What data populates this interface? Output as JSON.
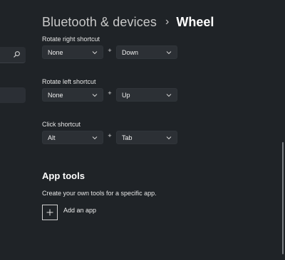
{
  "header": {
    "parent": "Bluetooth & devices",
    "separator": "›",
    "current": "Wheel"
  },
  "shortcuts": [
    {
      "label": "Rotate right shortcut",
      "modifier": "None",
      "key": "Down",
      "joiner": "+"
    },
    {
      "label": "Rotate left shortcut",
      "modifier": "None",
      "key": "Up",
      "joiner": "+"
    },
    {
      "label": "Click shortcut",
      "modifier": "Alt",
      "key": "Tab",
      "joiner": "+"
    }
  ],
  "app_tools": {
    "title": "App tools",
    "description": "Create your own tools for a specific app.",
    "add_label": "Add an app"
  },
  "icons": {
    "search": "search-icon",
    "chevron": "chevron-down-icon",
    "plus": "plus-icon"
  },
  "colors": {
    "background": "#1f2327",
    "control": "#2c3035",
    "text": "#e6e6e6"
  }
}
